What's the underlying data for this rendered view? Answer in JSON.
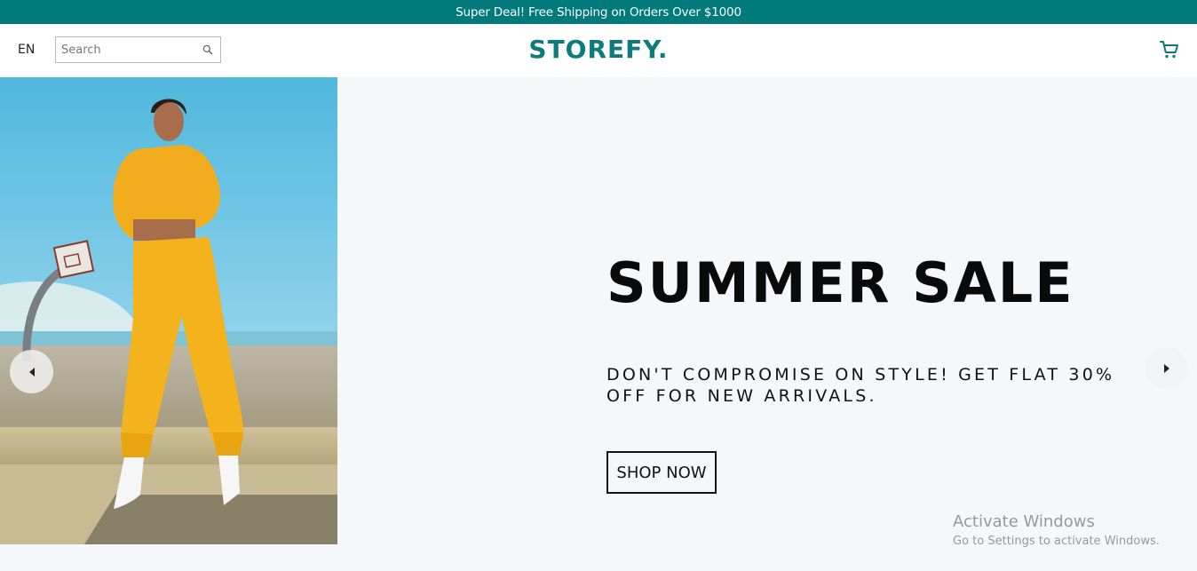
{
  "announcement": {
    "text": "Super Deal! Free Shipping on Orders Over $1000"
  },
  "navbar": {
    "language": "EN",
    "search": {
      "placeholder": "Search",
      "value": ""
    },
    "logo": "STOREFY.",
    "icons": {
      "search": "search-icon",
      "cart": "cart-icon"
    }
  },
  "slider": {
    "title": "SUMMER SALE",
    "description": "Don't compromise on style! Get flat 30% off for new arrivals.",
    "button_label": "SHOP NOW",
    "image_alt": "Model in yellow tracksuit by a basketball hoop"
  },
  "watermark": {
    "title": "Activate Windows",
    "subtitle": "Go to Settings to activate Windows."
  },
  "colors": {
    "brand": "#007a7a",
    "logo": "#0d7b7b",
    "slide_background": "#f4f8fb",
    "text": "#0a0a0a"
  }
}
